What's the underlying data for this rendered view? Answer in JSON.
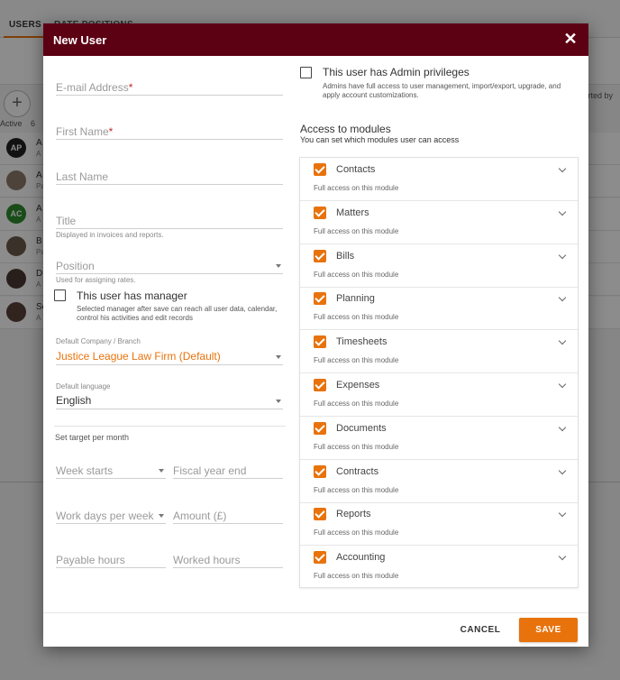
{
  "background": {
    "tabs": [
      "USERS",
      "RATE POSITIONS"
    ],
    "active_label": "Active",
    "active_count": "6",
    "sorted_label": "rted by",
    "rows": [
      {
        "initials": "AP",
        "name": "A",
        "sub": "A",
        "color": "#222222"
      },
      {
        "initials": "",
        "name": "A",
        "sub": "Pa",
        "color": "#8d7a6b"
      },
      {
        "initials": "AC",
        "name": "A",
        "sub": "A",
        "color": "#2e8b2e"
      },
      {
        "initials": "",
        "name": "B",
        "sub": "Pa",
        "color": "#6b5a4a"
      },
      {
        "initials": "",
        "name": "D",
        "sub": "A",
        "color": "#4a3a34"
      },
      {
        "initials": "",
        "name": "Se",
        "sub": "A",
        "color": "#5a4038"
      }
    ]
  },
  "modal": {
    "title": "New User",
    "close_icon": "close-icon",
    "colors": {
      "header": "#5c0014",
      "accent": "#e8730c"
    },
    "left": {
      "email": {
        "label": "E-mail Address",
        "required": "*"
      },
      "first_name": {
        "label": "First Name",
        "required": "*"
      },
      "last_name": {
        "label": "Last Name"
      },
      "title": {
        "label": "Title",
        "hint": "Displayed in invoices and reports."
      },
      "position": {
        "label": "Position",
        "hint": "Used for assigning rates."
      },
      "manager": {
        "label": "This user has manager",
        "desc": "Selected manager after save can reach all user data, calendar, control his activities and edit records"
      },
      "company": {
        "label": "Default Company / Branch",
        "value": "Justice League Law Firm (Default)"
      },
      "language": {
        "label": "Default language",
        "value": "English"
      },
      "target_title": "Set target per month",
      "week_starts": "Week starts",
      "fiscal_year_end": "Fiscal year end",
      "work_days": "Work days per week",
      "amount": "Amount (£)",
      "payable_hours": "Payable hours",
      "worked_hours": "Worked hours"
    },
    "right": {
      "admin": {
        "label": "This user has Admin privileges",
        "desc": "Admins have full access to user management, import/export, upgrade, and apply account customizations."
      },
      "modules_title": "Access to modules",
      "modules_sub": "You can set which modules user can access",
      "modules": [
        {
          "name": "Contacts",
          "access": "Full access on this module"
        },
        {
          "name": "Matters",
          "access": "Full access on this module"
        },
        {
          "name": "Bills",
          "access": "Full access on this module"
        },
        {
          "name": "Planning",
          "access": "Full access on this module"
        },
        {
          "name": "Timesheets",
          "access": "Full access on this module"
        },
        {
          "name": "Expenses",
          "access": "Full access on this module"
        },
        {
          "name": "Documents",
          "access": "Full access on this module"
        },
        {
          "name": "Contracts",
          "access": "Full access on this module"
        },
        {
          "name": "Reports",
          "access": "Full access on this module"
        },
        {
          "name": "Accounting",
          "access": "Full access on this module"
        }
      ]
    },
    "footer": {
      "cancel": "CANCEL",
      "save": "SAVE"
    }
  }
}
